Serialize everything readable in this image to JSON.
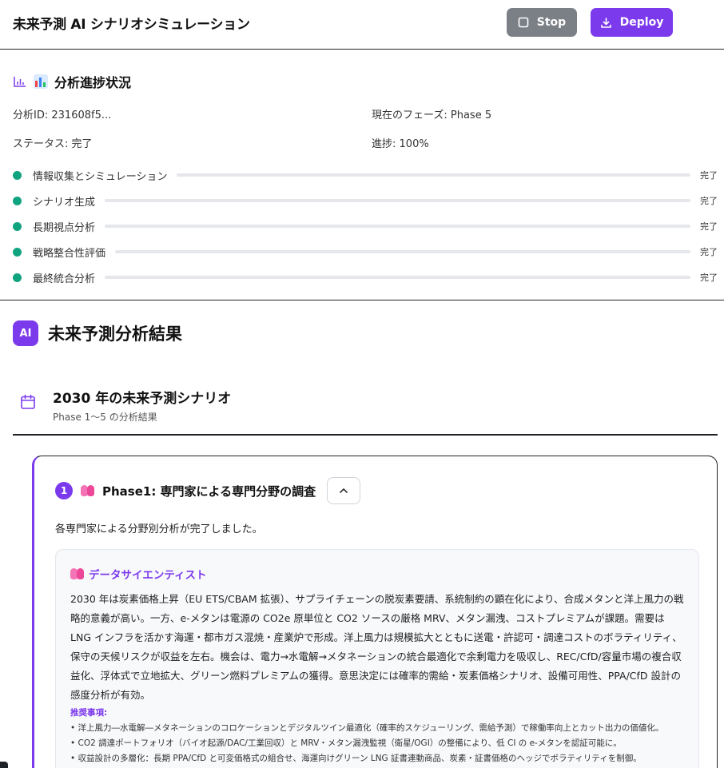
{
  "header": {
    "title": "未来予測 AI シナリオシミュレーション",
    "stop_label": "Stop",
    "deploy_label": "Deploy"
  },
  "colors": {
    "accent": "#7c3aed",
    "progress": "#10a37f",
    "stop_button": "#7b7f86"
  },
  "progress": {
    "title": "分析進捗状況",
    "icon": "bar-chart-icon",
    "analysis_id_label": "分析ID:",
    "analysis_id": "231608f5...",
    "phase_label": "現在のフェーズ:",
    "phase": "Phase 5",
    "status_label": "ステータス:",
    "status": "完了",
    "progress_label": "進捗:",
    "progress_value": "100%",
    "steps": [
      {
        "label": "情報収集とシミュレーション",
        "state": "完了",
        "progress": 1.0
      },
      {
        "label": "シナリオ生成",
        "state": "完了",
        "progress": 1.0
      },
      {
        "label": "長期視点分析",
        "state": "完了",
        "progress": 1.0
      },
      {
        "label": "戦略整合性評価",
        "state": "完了",
        "progress": 1.0
      },
      {
        "label": "最終統合分析",
        "state": "完了",
        "progress": 1.0
      }
    ]
  },
  "results": {
    "badge": "AI",
    "title": "未来予測分析結果",
    "scenario": {
      "title": "2030 年の未来予測シナリオ",
      "subtitle": "Phase 1〜5 の分析結果"
    },
    "phase": {
      "number": "1",
      "title": "Phase1: 専門家による専門分野の調査",
      "summary": "各専門家による分野別分析が完了しました。",
      "expert": {
        "name": "データサイエンティスト",
        "body": "2030 年は炭素価格上昇（EU ETS/CBAM 拡張）、サプライチェーンの脱炭素要請、系統制約の顕在化により、合成メタンと洋上風力の戦略的意義が高い。一方、e-メタンは電源の CO2e 原単位と CO2 ソースの厳格 MRV、メタン漏洩、コストプレミアムが課題。需要は LNG インフラを活かす海運・都市ガス混焼・産業炉で形成。洋上風力は規模拡大とともに送電・許認可・調達コストのボラティリティ、保守の天候リスクが収益を左右。機会は、電力→水電解→メタネーションの統合最適化で余剰電力を吸収し、REC/CfD/容量市場の複合収益化、浮体式で立地拡大、グリーン燃料プレミアムの獲得。意思決定には確率的需給・炭素価格シナリオ、設備可用性、PPA/CfD 設計の感度分析が有効。",
        "recommendations_title": "推奨事項:",
        "recommendations": [
          "• 洋上風力―水電解―メタネーションのコロケーションとデジタルツイン最適化（確率的スケジューリング、需給予測）で稼働率向上とカット出力の価値化。",
          "• CO2 調達ポートフォリオ（バイオ起源/DAC/工業回収）と MRV・メタン漏洩監視（衛星/OGI）の整備により、低 CI の e-メタンを認証可能に。",
          "• 収益設計の多層化：長期 PPA/CfD と可変価格式の組合せ、海運向けグリーン LNG 証書連動商品、炭素・証書価格のヘッジでボラティリティを制御。"
        ]
      }
    }
  }
}
